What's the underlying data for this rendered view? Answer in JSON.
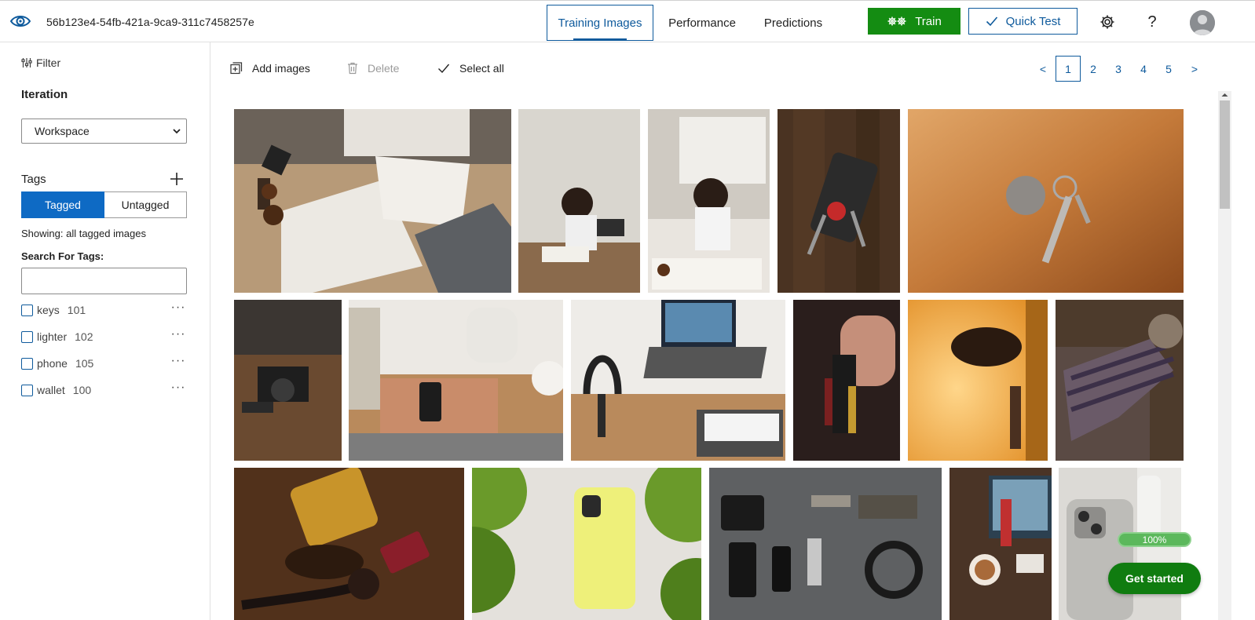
{
  "header": {
    "project_id": "56b123e4-54fb-421a-9ca9-311c7458257e",
    "tabs": [
      {
        "label": "Training Images",
        "active": true
      },
      {
        "label": "Performance",
        "active": false
      },
      {
        "label": "Predictions",
        "active": false
      }
    ],
    "train_label": "Train",
    "quick_test_label": "Quick Test",
    "icons": [
      "eye-logo-icon",
      "gear-icon",
      "help-icon",
      "avatar"
    ]
  },
  "sidebar": {
    "filter_label": "Filter",
    "iteration_title": "Iteration",
    "iteration_selected": "Workspace",
    "tags_title": "Tags",
    "segments": {
      "tagged": "Tagged",
      "untagged": "Untagged",
      "selected": "Tagged"
    },
    "showing_text": "Showing: all tagged images",
    "search_label": "Search For Tags:",
    "search_value": "",
    "tags": [
      {
        "name": "keys",
        "count": "101"
      },
      {
        "name": "lighter",
        "count": "102"
      },
      {
        "name": "phone",
        "count": "105"
      },
      {
        "name": "wallet",
        "count": "100"
      }
    ]
  },
  "toolbar": {
    "add_images": "Add images",
    "delete": "Delete",
    "select_all": "Select all"
  },
  "pagination": {
    "prev": "<",
    "pages": [
      "1",
      "2",
      "3",
      "4",
      "5"
    ],
    "current": "1",
    "next": ">"
  },
  "floating": {
    "progress_text": "100%",
    "progress_value": 1.0,
    "get_started_label": "Get started"
  },
  "colors": {
    "accent_blue": "#0e5a9c",
    "segment_blue": "#0e6ac4",
    "train_green": "#148c12",
    "get_started_green": "#107c10"
  }
}
